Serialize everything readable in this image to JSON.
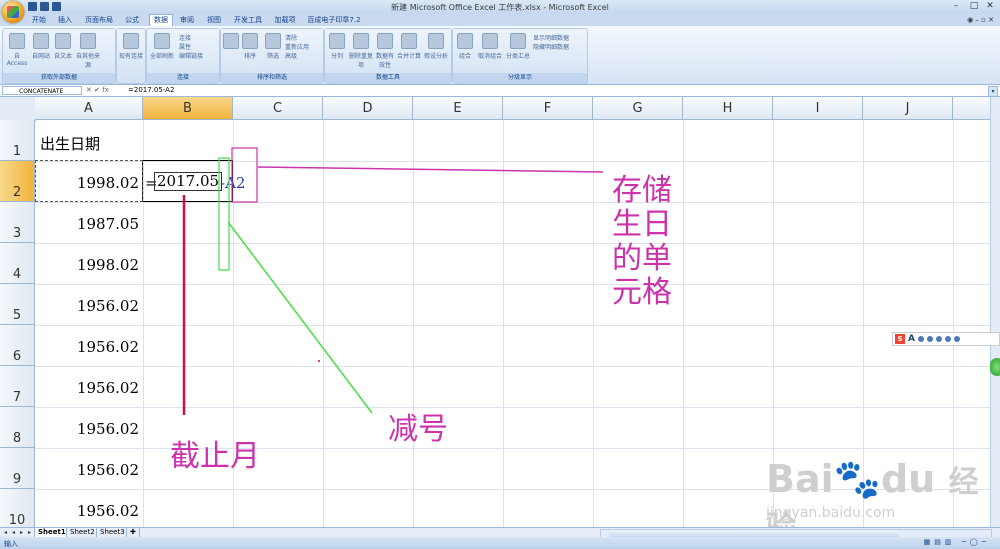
{
  "window": {
    "title": "新建 Microsoft Office Excel 工作表.xlsx - Microsoft Excel",
    "controls": [
      "–",
      "□",
      "✕"
    ]
  },
  "ribbon_tabs": [
    "开始",
    "插入",
    "页面布局",
    "公式",
    "数据",
    "审阅",
    "视图",
    "开发工具",
    "加载项",
    "百成电子印章7.2"
  ],
  "active_tab": "数据",
  "ribbon": {
    "get_external": {
      "label": "获取外部数据",
      "buttons": [
        "自 Access",
        "自网站",
        "自文本",
        "自其他来源",
        "现有连接"
      ]
    },
    "connections": {
      "label": "连接",
      "buttons": [
        "全部刷新"
      ],
      "small": [
        "连接",
        "属性",
        "编辑链接"
      ]
    },
    "sort_filter": {
      "label": "排序和筛选",
      "buttons": [
        "排序",
        "筛选"
      ],
      "small": [
        "清除",
        "重新应用",
        "高级"
      ]
    },
    "data_tools": {
      "label": "数据工具",
      "buttons": [
        "分列",
        "删除重复项",
        "数据有效性",
        "合并计算",
        "假设分析"
      ]
    },
    "outline": {
      "label": "分级显示",
      "buttons": [
        "组合",
        "取消组合",
        "分类汇总"
      ],
      "small": [
        "显示明细数据",
        "隐藏明细数据"
      ]
    }
  },
  "formula_bar": {
    "name_box": "CONCATENATE",
    "fx": "fx",
    "formula": "=2017.05-A2"
  },
  "columns": [
    "A",
    "B",
    "C",
    "D",
    "E",
    "F",
    "G",
    "H",
    "I",
    "J"
  ],
  "rows": [
    "1",
    "2",
    "3",
    "4",
    "5",
    "6",
    "7",
    "8",
    "9",
    "10"
  ],
  "cells": {
    "A1": "出生日期",
    "A2": "1998.02",
    "A3": "1987.05",
    "A4": "1998.02",
    "A5": "1956.02",
    "A6": "1956.02",
    "A7": "1956.02",
    "A8": "1956.02",
    "A9": "1956.02",
    "A10": "1956.02",
    "B2_prefix": "=",
    "B2_value": "2017.05",
    "B2_suffix": "-A2"
  },
  "annotations": {
    "storage_cell": "存储\n生日\n的单\n元格",
    "storage_cell_lines": [
      "存储",
      "生日",
      "的单",
      "元格"
    ],
    "minus_sign": "减号",
    "cutoff_month": "截止月",
    "colors": {
      "magenta": "#cc33aa",
      "green": "#44dd44",
      "crimson": "#cc1144"
    }
  },
  "sheets": [
    "Sheet1",
    "Sheet2",
    "Sheet3"
  ],
  "status": {
    "mode": "输入"
  },
  "watermark": {
    "brand": "Bai",
    "brand2": "du",
    "product": "经验",
    "url": "jingyan.baidu.com"
  }
}
